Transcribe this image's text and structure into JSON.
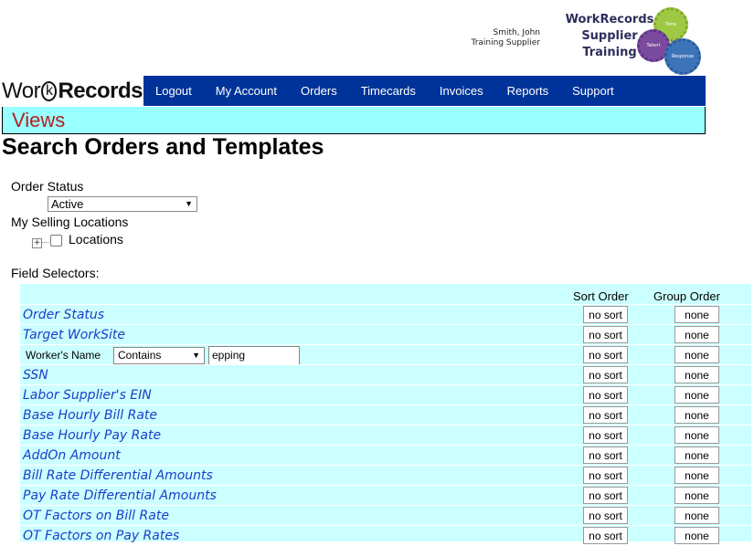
{
  "user": {
    "name": "Smith, John",
    "role": "Training Supplier"
  },
  "logo": {
    "line1": "WorkRecords",
    "line2": "Supplier",
    "line3": "Training",
    "gear1": "Time",
    "gear2": "Talent",
    "gear3": "Response"
  },
  "brand": {
    "work": "Wor",
    "k": "k",
    "records": "Records"
  },
  "nav": [
    "Logout",
    "My Account",
    "Orders",
    "Timecards",
    "Invoices",
    "Reports",
    "Support"
  ],
  "views_title": "Views",
  "page_title": "Search Orders and Templates",
  "order_status": {
    "label": "Order Status",
    "selected": "Active"
  },
  "selling_locations": {
    "label": "My Selling Locations",
    "tree_item": "Locations"
  },
  "field_selectors": {
    "label": "Field Selectors:",
    "sort_header": "Sort Order",
    "group_header": "Group Order",
    "rows": [
      {
        "field": "Order Status",
        "sort": "no sort",
        "group": "none"
      },
      {
        "field": "Target WorkSite",
        "sort": "no sort",
        "group": "none"
      },
      {
        "field": "Worker's Name",
        "operator": "Contains",
        "value": "epping",
        "sort": "no sort",
        "group": "none"
      },
      {
        "field": "SSN",
        "sort": "no sort",
        "group": "none"
      },
      {
        "field": "Labor Supplier's EIN",
        "sort": "no sort",
        "group": "none"
      },
      {
        "field": "Base Hourly Bill Rate",
        "sort": "no sort",
        "group": "none"
      },
      {
        "field": "Base Hourly Pay Rate",
        "sort": "no sort",
        "group": "none"
      },
      {
        "field": "AddOn Amount",
        "sort": "no sort",
        "group": "none"
      },
      {
        "field": "Bill Rate Differential Amounts",
        "sort": "no sort",
        "group": "none"
      },
      {
        "field": "Pay Rate Differential Amounts",
        "sort": "no sort",
        "group": "none"
      },
      {
        "field": "OT Factors on Bill Rate",
        "sort": "no sort",
        "group": "none"
      },
      {
        "field": "OT Factors on Pay Rates",
        "sort": "no sort",
        "group": "none"
      }
    ]
  },
  "colors": {
    "nav_bg": "#003399",
    "panel_bg": "#ccffff",
    "views_bg": "#99ffff",
    "views_text": "#b52020",
    "link": "#1a3ec8"
  }
}
